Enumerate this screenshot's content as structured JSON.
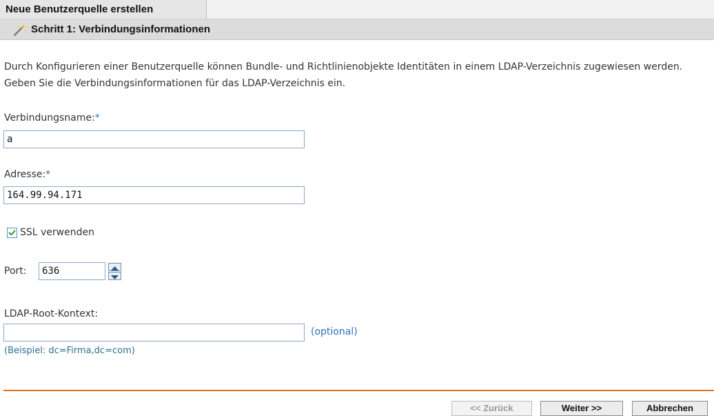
{
  "header": {
    "title": "Neue Benutzerquelle erstellen",
    "step_title": "Schritt 1: Verbindungsinformationen",
    "step_icon": "wand-icon"
  },
  "description": "Durch Konfigurieren einer Benutzerquelle können Bundle- und Richtlinienobjekte Identitäten in einem LDAP-Verzeichnis zugewiesen werden. Geben Sie die Verbindungsinformationen für das LDAP-Verzeichnis ein.",
  "form": {
    "connection_name": {
      "label": "Verbindungsname:",
      "required_mark": "*",
      "value": "a"
    },
    "address": {
      "label": "Adresse:",
      "required_mark": "*",
      "value": "164.99.94.171"
    },
    "ssl": {
      "label": "SSL verwenden",
      "checked": true
    },
    "port": {
      "label": "Port:",
      "value": "636"
    },
    "ldap_root": {
      "label": "LDAP-Root-Kontext:",
      "value": "",
      "optional_link": "(optional)",
      "example": "(Beispiel: dc=Firma,dc=com)"
    }
  },
  "footer": {
    "back_label": "<< Zurück",
    "next_label": "Weiter >>",
    "cancel_label": "Abbrechen"
  },
  "colors": {
    "accent_separator": "#e0701a",
    "link": "#2c6fbd",
    "required": "#2c6fbd"
  }
}
